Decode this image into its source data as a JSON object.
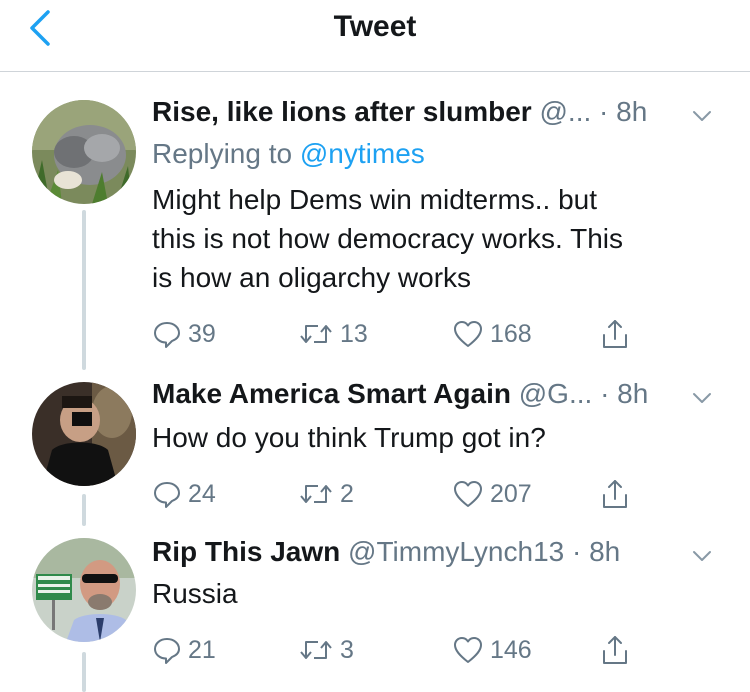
{
  "header": {
    "title": "Tweet"
  },
  "tweets": [
    {
      "name": "Rise, like lions after slumber",
      "handle": "@...",
      "time": "· 8h",
      "replying_label": "Replying to",
      "replying_handle": "@nytimes",
      "lines": [
        "Might help Dems win midterms.. but",
        "this is not how democracy works. This",
        "is how an oligarchy works"
      ],
      "replies": "39",
      "retweets": "13",
      "likes": "168"
    },
    {
      "name": "Make America Smart Again",
      "handle": "@G...",
      "time": "· 8h",
      "lines": [
        "How do you think Trump got in?"
      ],
      "replies": "24",
      "retweets": "2",
      "likes": "207"
    },
    {
      "name": "Rip This Jawn",
      "handle": "@TimmyLynch13",
      "time": "· 8h",
      "lines": [
        "Russia"
      ],
      "replies": "21",
      "retweets": "3",
      "likes": "146"
    }
  ],
  "icons": {
    "back": "chevron-left-icon",
    "caret": "chevron-down-icon",
    "reply": "reply-icon",
    "retweet": "retweet-icon",
    "like": "heart-icon",
    "share": "share-icon"
  },
  "colors": {
    "accent": "#1da1f2",
    "secondary_text": "#657786",
    "primary_text": "#14171a"
  }
}
